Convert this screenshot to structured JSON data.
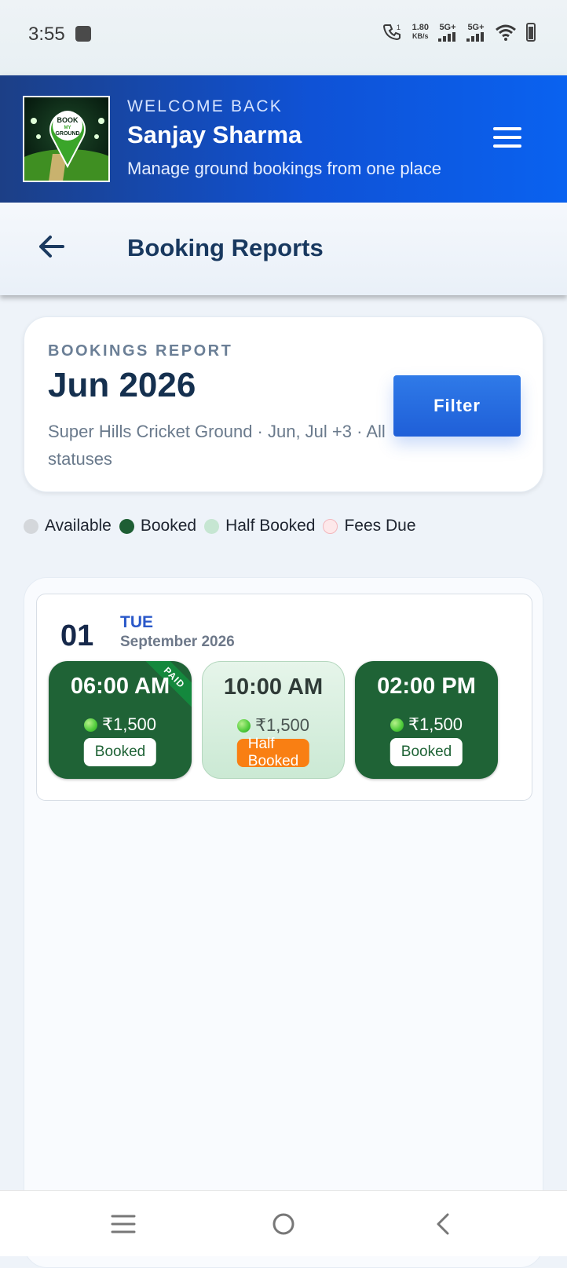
{
  "status_bar": {
    "time": "3:55",
    "speed_value": "1.80",
    "speed_unit": "KB/s",
    "signal_1": "5G+",
    "signal_2": "5G+",
    "icons": [
      "usb-icon",
      "wifi-call-icon",
      "signal-icon",
      "wifi-icon",
      "battery-icon"
    ]
  },
  "header": {
    "logo_text": [
      "BOOK",
      "MY",
      "GROUND"
    ],
    "welcome": "WELCOME BACK",
    "user_name": "Sanjay Sharma",
    "subtitle": "Manage ground bookings from one place",
    "menu_icon": "hamburger-icon"
  },
  "page": {
    "back_icon": "arrow-left-icon",
    "title": "Booking Reports"
  },
  "report": {
    "label": "BOOKINGS REPORT",
    "month": "Jun 2026",
    "description": "Super Hills Cricket Ground · Jun, Jul +3 · All statuses",
    "filter_label": "Filter"
  },
  "legend": [
    {
      "label": "Available",
      "color": "#d4d7db"
    },
    {
      "label": "Booked",
      "color": "#1e5e34"
    },
    {
      "label": "Half Booked",
      "color": "#c6e6d2"
    },
    {
      "label": "Fees Due",
      "color": "#fde8ea"
    }
  ],
  "day": {
    "number": "01",
    "weekday": "TUE",
    "month_year": "September 2026",
    "slots": [
      {
        "time": "06:00 AM",
        "price": "₹1,500",
        "status": "Booked",
        "ribbon": "PAID"
      },
      {
        "time": "10:00 AM",
        "price": "₹1,500",
        "status": "Half Booked"
      },
      {
        "time": "02:00 PM",
        "price": "₹1,500",
        "status": "Booked"
      }
    ]
  },
  "colors": {
    "header_start": "#1c3f86",
    "header_end": "#0a62f0",
    "booked": "#1f6336",
    "half_badge": "#f97f13",
    "filter": "#2a6de2"
  },
  "nav": {
    "icons": [
      "recents-icon",
      "home-icon",
      "back-nav-icon"
    ]
  }
}
